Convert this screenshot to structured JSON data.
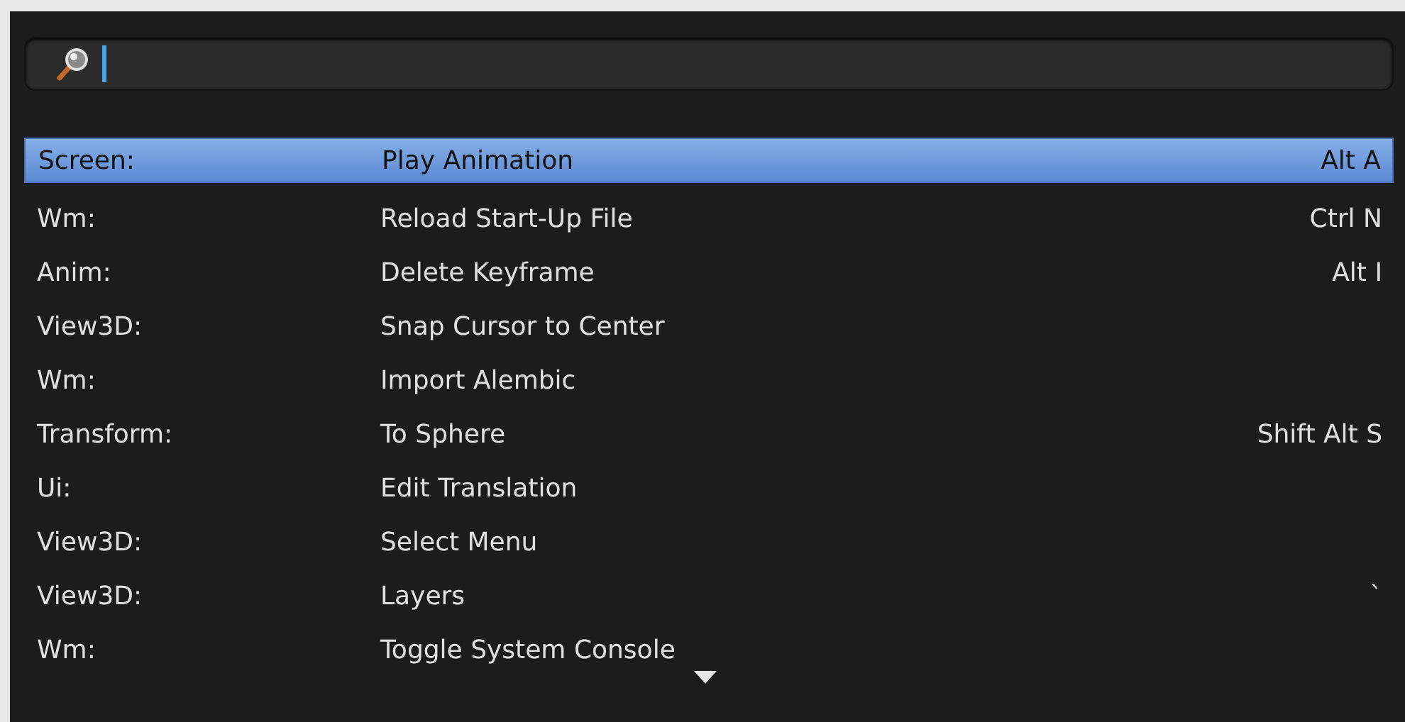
{
  "results": [
    {
      "category": "Screen:",
      "name": "Play Animation",
      "shortcut": "Alt A",
      "selected": true
    },
    {
      "category": "Wm:",
      "name": "Reload Start-Up File",
      "shortcut": "Ctrl N",
      "selected": false
    },
    {
      "category": "Anim:",
      "name": "Delete Keyframe",
      "shortcut": "Alt I",
      "selected": false
    },
    {
      "category": "View3D:",
      "name": "Snap Cursor to Center",
      "selected": false
    },
    {
      "category": "Wm:",
      "name": "Import Alembic",
      "selected": false
    },
    {
      "category": "Transform:",
      "name": "To Sphere",
      "shortcut": "Shift Alt S",
      "selected": false
    },
    {
      "category": "Ui:",
      "name": "Edit Translation",
      "selected": false
    },
    {
      "category": "View3D:",
      "name": "Select Menu",
      "selected": false
    },
    {
      "category": "View3D:",
      "name": "Layers",
      "shortcut": "`",
      "selected": false
    },
    {
      "category": "Wm:",
      "name": "Toggle System Console",
      "selected": false
    }
  ]
}
